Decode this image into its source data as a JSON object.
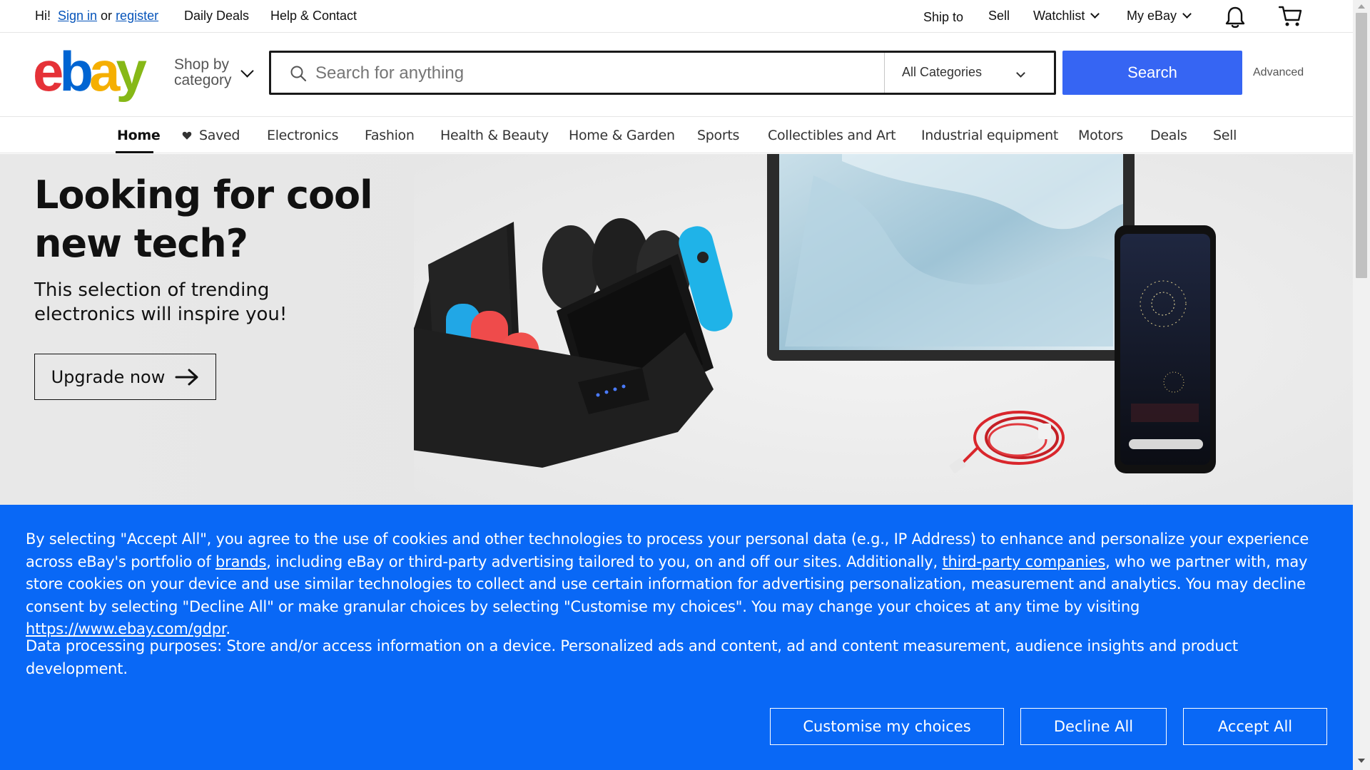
{
  "topbar": {
    "greeting": "Hi!",
    "sign_in": "Sign in",
    "or": "or",
    "register": "register",
    "daily_deals": "Daily Deals",
    "help_contact": "Help & Contact",
    "ship_to": "Ship to",
    "sell": "Sell",
    "watchlist": "Watchlist",
    "my_ebay": "My eBay"
  },
  "header": {
    "logo": {
      "e": "e",
      "b": "b",
      "a": "a",
      "y": "y"
    },
    "shop_by_category": "Shop by category",
    "search_placeholder": "Search for anything",
    "category_selected": "All Categories",
    "search_button": "Search",
    "advanced": "Advanced"
  },
  "catnav": {
    "items": [
      "Home",
      "Saved",
      "Electronics",
      "Fashion",
      "Health & Beauty",
      "Home & Garden",
      "Sports",
      "Collectibles and Art",
      "Industrial equipment",
      "Motors",
      "Deals",
      "Sell"
    ],
    "active": "Home"
  },
  "hero": {
    "title": "Looking for cool new tech?",
    "subtitle": "This selection of trending electronics will inspire you!",
    "cta": "Upgrade now"
  },
  "cookie": {
    "p1_a": "By selecting \"Accept All\", you agree to the use of cookies and other technologies to process your personal data (e.g., IP Address) to enhance and personalize your experience across eBay's portfolio of ",
    "brands_link": "brands",
    "p1_b": ", including eBay or third-party advertising tailored to you, on and off our sites. Additionally, ",
    "third_party_link": "third-party companies",
    "p1_c": ", who we partner with, may store cookies on your device and use similar technologies to collect and use certain information for advertising personalization, measurement and analytics. You may decline consent by selecting \"Decline All\" or make granular choices by selecting \"Customise my choices\". You may change your choices at any time by visiting ",
    "gdpr_link": "https://www.ebay.com/gdpr",
    "p1_d": ".",
    "p2": "Data processing purposes: Store and/or access information on a device. Personalized ads and content, ad and content measurement, audience insights and product development.",
    "customise": "Customise my choices",
    "decline": "Decline All",
    "accept": "Accept All"
  },
  "colors": {
    "ebay_red": "#e53238",
    "ebay_blue": "#0064d2",
    "ebay_yellow": "#f5af02",
    "ebay_green": "#86b817",
    "search_button": "#3665f3",
    "cookie_banner": "#0968f6"
  },
  "icons": [
    "search-icon",
    "chevron-down-icon",
    "bell-icon",
    "cart-icon",
    "heart-icon",
    "arrow-right-icon"
  ]
}
